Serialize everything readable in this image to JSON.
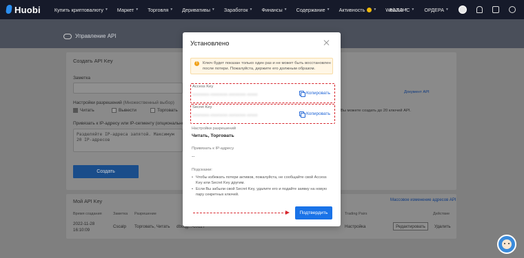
{
  "nav": {
    "logo": "Huobi",
    "items": [
      "Купить криптовалюту",
      "Маркет",
      "Торговля",
      "Деривативы",
      "Заработок",
      "Финансы",
      "Содержание",
      "Активность",
      "Web3.0"
    ],
    "right": [
      "БАЛАНС",
      "ОРДЕРА"
    ]
  },
  "page": {
    "title": "Управление API",
    "create": {
      "heading": "Создать API Key",
      "note_label": "Заметка",
      "permissions_label": "Настройки разрешений",
      "permissions_hint": "(Множественный выбор)",
      "perm_read": "Читать",
      "perm_withdraw": "Вывести",
      "perm_trade": "Торговать",
      "ip_label": "Привязать к IP-адресу или IP-сегменту (опционально)",
      "ip_placeholder": "Разделяйте IP-адреса запятой. Максимум 20 IP-адресов",
      "submit": "Создать"
    },
    "info": {
      "line1": "Вы можете создать до 20 ключей API.",
      "link": "Документ API"
    },
    "my_keys": {
      "heading": "Мой API Key",
      "bulk_link": "Массовое изменение адресов API",
      "columns": [
        "Время создания",
        "Заметка",
        "Разрешение",
        "Ключ",
        "Trading Pairs",
        "Действие"
      ],
      "row": {
        "date": "2022-11-28",
        "time": "16:10:09",
        "note": "Cscalp",
        "perm": "Торговать, Читать",
        "key": "dbuqg...-c0127",
        "settings": "Настройка",
        "edit": "Редактировать",
        "delete": "Удалить"
      }
    }
  },
  "modal": {
    "title": "Установлено",
    "warning": "Ключ будет показан только один раз и не может быть восстановлен после потери. Пожалуйста, держите его должным образом.",
    "access_key_label": "Access Key",
    "access_key_value": "xxxxxxxx-xxxxxxxx-xxxxxxxx-xxxxx",
    "secret_key_label": "Secret Key",
    "secret_key_value": "xxxxxxxx-xxxxxxxx-xxxxxxxx-xxxxx",
    "copy_label": "Копировать",
    "perm_label": "Настройки разрешений",
    "perm_value": "Читать, Торговать",
    "ip_label": "Привязать к IP-адресу",
    "ip_value": "--",
    "tips_label": "Подсказки:",
    "tip1": "Чтобы избежать потери активов, пожалуйста, не сообщайте свой Access Key или Secret Key другим.",
    "tip2": "Если Вы забыли свой Secret Key, удалите его и подайте заявку на новую пару секретных ключей.",
    "confirm": "Подтвердить"
  }
}
